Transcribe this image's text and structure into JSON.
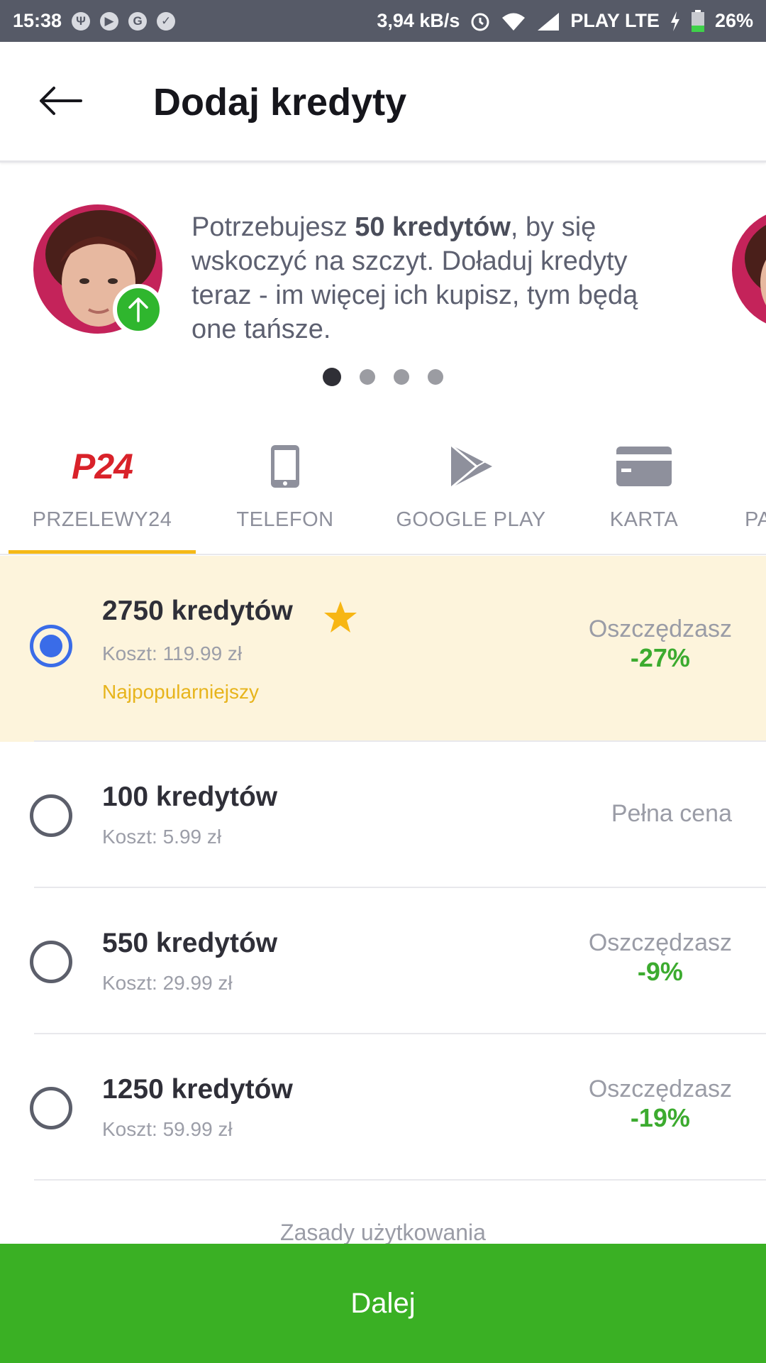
{
  "status_bar": {
    "time": "15:38",
    "left_icons": [
      "usb-icon",
      "play-icon",
      "g-icon",
      "shield-icon"
    ],
    "net_speed": "3,94 kB/s",
    "carrier": "PLAY LTE",
    "battery": "26%"
  },
  "header": {
    "title": "Dodaj kredyty",
    "back_icon": "arrow-left-icon"
  },
  "promo": {
    "text_before": "Potrzebujesz ",
    "text_bold": "50 kredytów",
    "text_after": ", by się wskoczyć na szczyt. Doładuj kredyty teraz - im więcej ich kupisz, tym będą one tańsze.",
    "page_count": 4,
    "active_page": 1
  },
  "tabs": [
    {
      "label": "PRZELEWY24",
      "icon": "p24-logo",
      "logo_text": "P24",
      "active": true
    },
    {
      "label": "TELEFON",
      "icon": "phone-icon"
    },
    {
      "label": "GOOGLE PLAY",
      "icon": "google-play-icon"
    },
    {
      "label": "KARTA",
      "icon": "card-icon"
    },
    {
      "label": "PA",
      "icon": "partial-tab"
    }
  ],
  "options": [
    {
      "title": "2750 kredytów",
      "cost": "Koszt: 119.99 zł",
      "tag": "Najpopularniejszy",
      "save_label": "Oszczędzasz",
      "save_value": "-27%",
      "selected": true,
      "starred": true
    },
    {
      "title": "100 kredytów",
      "cost": "Koszt: 5.99 zł",
      "full_price": "Pełna cena",
      "selected": false
    },
    {
      "title": "550 kredytów",
      "cost": "Koszt: 29.99 zł",
      "save_label": "Oszczędzasz",
      "save_value": "-9%",
      "selected": false
    },
    {
      "title": "1250 kredytów",
      "cost": "Koszt: 59.99 zł",
      "save_label": "Oszczędzasz",
      "save_value": "-19%",
      "selected": false
    }
  ],
  "footer": {
    "terms": "Zasady użytkowania",
    "next_label": "Dalej"
  },
  "colors": {
    "accent_green": "#3ab024",
    "radio_blue": "#3a6ce8",
    "tab_indicator": "#f5b918",
    "selected_bg": "#fdf4dc",
    "savings_green": "#3cab2f"
  }
}
